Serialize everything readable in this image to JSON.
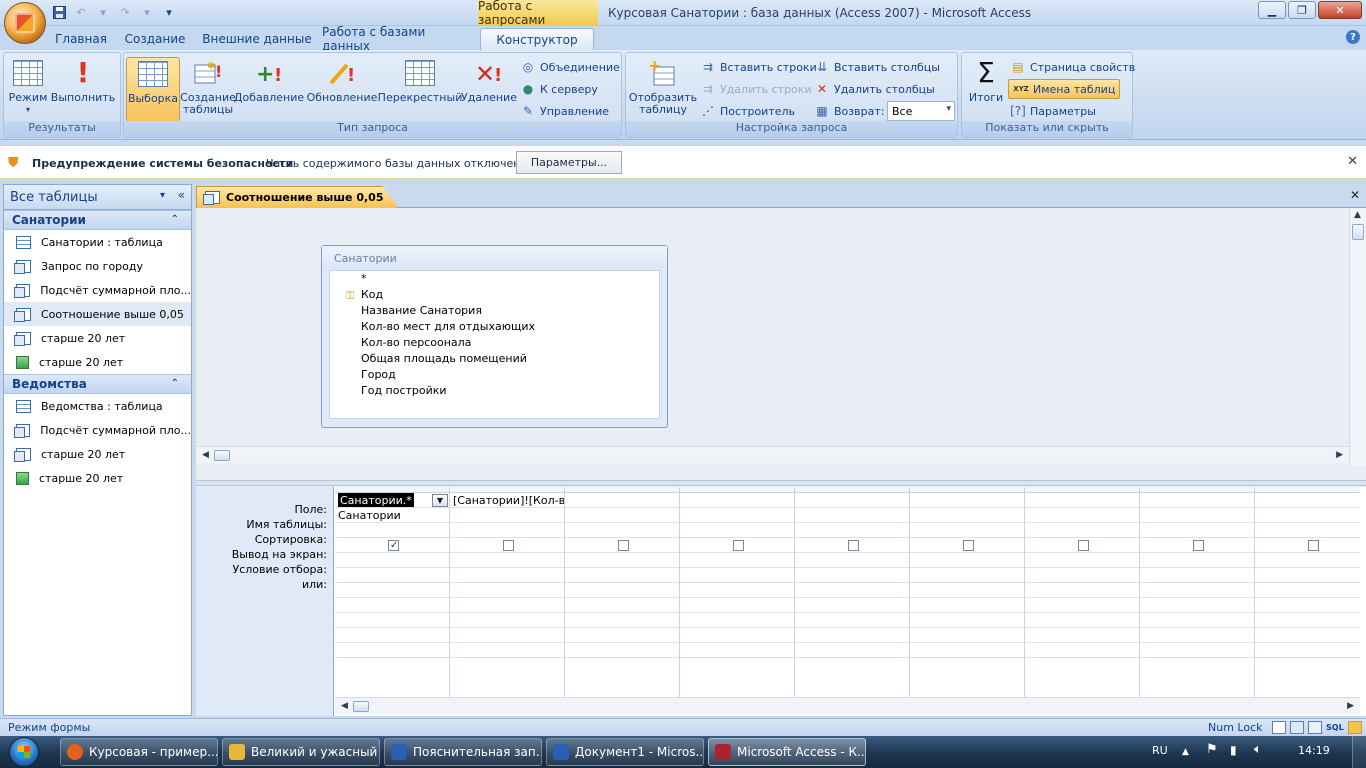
{
  "window": {
    "context_tab_title": "Работа с запросами",
    "title": "Курсовая Санатории : база данных (Access 2007)  -  Microsoft Access"
  },
  "ribbon_tabs": [
    "Главная",
    "Создание",
    "Внешние данные",
    "Работа с базами данных",
    "Конструктор"
  ],
  "ribbon": {
    "results": {
      "label": "Результаты",
      "mode": "Режим",
      "run": "Выполнить"
    },
    "query_type": {
      "label": "Тип запроса",
      "select": "Выборка",
      "make_table_1": "Создание",
      "make_table_2": "таблицы",
      "append": "Добавление",
      "update": "Обновление",
      "crosstab": "Перекрестный",
      "delete": "Удаление",
      "union": "Объединение",
      "passthrough": "К серверу",
      "ddl": "Управление"
    },
    "query_setup": {
      "label": "Настройка запроса",
      "show_table_1": "Отобразить",
      "show_table_2": "таблицу",
      "insert_rows": "Вставить строки",
      "delete_rows": "Удалить строки",
      "builder": "Построитель",
      "insert_cols": "Вставить столбцы",
      "delete_cols": "Удалить столбцы",
      "return_label": "Возврат:",
      "return_value": "Все"
    },
    "show_hide": {
      "label": "Показать или скрыть",
      "totals": "Итоги",
      "property_sheet": "Страница свойств",
      "table_names": "Имена таблиц",
      "parameters": "Параметры"
    }
  },
  "security_bar": {
    "title": "Предупреждение системы безопасности",
    "message": "Часть содержимого базы данных отключено",
    "button": "Параметры..."
  },
  "nav_pane": {
    "header": "Все таблицы",
    "groups": [
      {
        "name": "Санатории",
        "items": [
          {
            "label": "Санатории : таблица",
            "icon": "table"
          },
          {
            "label": "Запрос по городу",
            "icon": "query"
          },
          {
            "label": "Подсчёт суммарной пло...",
            "icon": "query"
          },
          {
            "label": "Соотношение выше 0,05",
            "icon": "query"
          },
          {
            "label": "старше 20 лет",
            "icon": "query"
          },
          {
            "label": "старше 20 лет",
            "icon": "form"
          }
        ]
      },
      {
        "name": "Ведомства",
        "items": [
          {
            "label": "Ведомства : таблица",
            "icon": "table"
          },
          {
            "label": "Подсчёт суммарной пло...",
            "icon": "query"
          },
          {
            "label": "старше 20 лет",
            "icon": "query"
          },
          {
            "label": "старше 20 лет",
            "icon": "form"
          }
        ]
      }
    ]
  },
  "document": {
    "tab_title": "Соотношение выше 0,05",
    "table_box": {
      "title": "Санатории",
      "fields": [
        "*",
        "Код",
        "Название Санатория",
        "Кол-во мест для отдыхающих",
        "Кол-во персоонала",
        "Общая площадь помещений",
        "Город",
        "Год постройки"
      ]
    },
    "qbe": {
      "row_labels": [
        "Поле:",
        "Имя таблицы:",
        "Сортировка:",
        "Вывод на экран:",
        "Условие отбора:",
        "или:"
      ],
      "columns": [
        {
          "field": "Санатории.*",
          "table": "Санатории",
          "show": true
        },
        {
          "field": "[Санатории]![Кол-во",
          "table": "",
          "show": false
        },
        {
          "field": "",
          "table": "",
          "show": false
        },
        {
          "field": "",
          "table": "",
          "show": false
        },
        {
          "field": "",
          "table": "",
          "show": false
        },
        {
          "field": "",
          "table": "",
          "show": false
        },
        {
          "field": "",
          "table": "",
          "show": false
        },
        {
          "field": "",
          "table": "",
          "show": false
        },
        {
          "field": "",
          "table": "",
          "show": false
        }
      ]
    }
  },
  "status_bar": {
    "left": "Режим формы",
    "numlock": "Num Lock",
    "view_sql": "SQL"
  },
  "taskbar": {
    "buttons": [
      {
        "label": "Курсовая - пример....",
        "icon_color": "#e2621b"
      },
      {
        "label": "Великий и ужасный Я",
        "icon_color": "#e8b63a"
      },
      {
        "label": "Пояснительная зап...",
        "icon_color": "#2b5fb4"
      },
      {
        "label": "Документ1 - Micros...",
        "icon_color": "#2b5fb4"
      },
      {
        "label": "Microsoft Access - К...",
        "icon_color": "#a8242f"
      }
    ],
    "lang": "RU",
    "time": "14:19"
  }
}
